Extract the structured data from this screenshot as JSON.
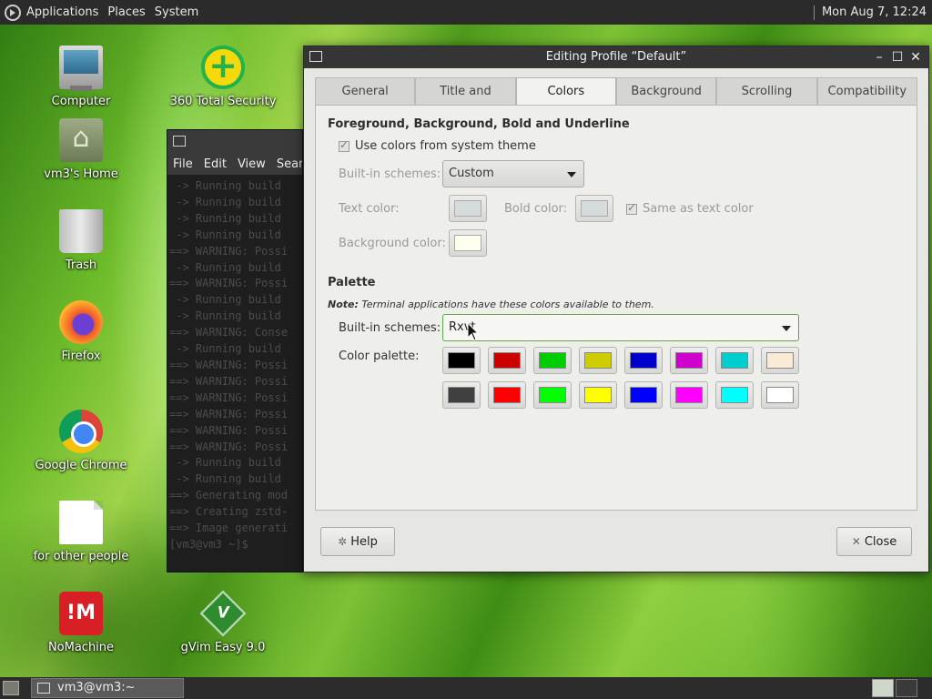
{
  "top_panel": {
    "menus": [
      "Applications",
      "Places",
      "System"
    ],
    "clock": "Mon Aug  7, 12:24"
  },
  "desktop_icons": [
    {
      "label": "Computer",
      "icon": "computer-icon"
    },
    {
      "label": "vm3's Home",
      "icon": "home-folder-icon"
    },
    {
      "label": "Trash",
      "icon": "trash-icon"
    },
    {
      "label": "Firefox",
      "icon": "firefox-icon"
    },
    {
      "label": "Google Chrome",
      "icon": "chrome-icon"
    },
    {
      "label": "for other people",
      "icon": "document-icon"
    },
    {
      "label": "NoMachine",
      "icon": "nomachine-icon"
    },
    {
      "label": "360 Total Security",
      "icon": "360-security-icon"
    },
    {
      "label": "gVim Easy 9.0",
      "icon": "gvim-icon"
    }
  ],
  "terminal": {
    "menus": [
      "File",
      "Edit",
      "View",
      "Search"
    ],
    "lines": [
      " -> Running build",
      " -> Running build",
      " -> Running build",
      " -> Running build",
      "==> WARNING: Possi",
      " -> Running build",
      "==> WARNING: Possi",
      " -> Running build",
      " -> Running build",
      "==> WARNING: Conse",
      " -> Running build",
      "==> WARNING: Possi",
      "==> WARNING: Possi",
      "==> WARNING: Possi",
      "==> WARNING: Possi",
      "==> WARNING: Possi",
      "==> WARNING: Possi",
      " -> Running build",
      " -> Running build",
      "==> Generating mod",
      "==> Creating zstd-",
      "",
      "==> Image generati",
      "[vm3@vm3 ~]$ "
    ]
  },
  "dialog": {
    "title": "Editing Profile “Default”",
    "tabs": [
      "General",
      "Title and Command",
      "Colors",
      "Background",
      "Scrolling",
      "Compatibility"
    ],
    "active_tab": "Colors",
    "section1_title": "Foreground, Background, Bold and Underline",
    "use_system_colors_label": "Use colors from system theme",
    "use_system_colors_checked": true,
    "builtin_schemes_label": "Built-in schemes:",
    "fg_scheme_value": "Custom",
    "text_color_label": "Text color:",
    "bold_color_label": "Bold color:",
    "same_as_text_label": "Same as text color",
    "same_as_text_checked": true,
    "background_color_label": "Background color:",
    "text_color": "#d6dcdc",
    "bold_color": "#d6dcdc",
    "background_color": "#fffff0",
    "palette_title": "Palette",
    "palette_note_bold": "Note:",
    "palette_note_text": "Terminal applications have these colors available to them.",
    "palette_scheme_label": "Built-in schemes:",
    "palette_scheme_value": "Rxvt",
    "color_palette_label": "Color palette:",
    "palette_row1": [
      "#000000",
      "#cd0000",
      "#00cd00",
      "#cdcd00",
      "#0000cd",
      "#cd00cd",
      "#00cdcd",
      "#faebd7"
    ],
    "palette_row2": [
      "#404040",
      "#ff0000",
      "#00ff00",
      "#ffff00",
      "#0000ff",
      "#ff00ff",
      "#00ffff",
      "#ffffff"
    ],
    "help_label": "Help",
    "close_label": "Close"
  },
  "bottom_panel": {
    "task_label": "vm3@vm3:~"
  }
}
